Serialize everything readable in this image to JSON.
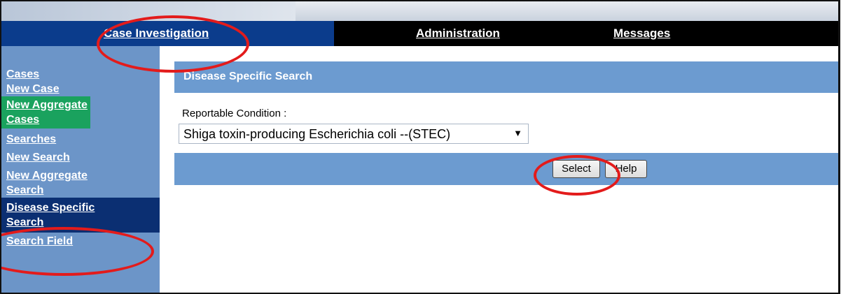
{
  "nav": {
    "case_investigation": "Case Investigation",
    "administration": "Administration",
    "messages": "Messages"
  },
  "sidebar": {
    "items": [
      {
        "label": "Cases"
      },
      {
        "label": "New Case"
      },
      {
        "label": "New Aggregate Cases"
      },
      {
        "label": "Searches"
      },
      {
        "label": "New Search"
      },
      {
        "label": "New Aggregate Search"
      },
      {
        "label": "Disease Specific Search"
      },
      {
        "label": "Search Field"
      }
    ]
  },
  "main": {
    "panel_title": "Disease Specific Search",
    "field_label": "Reportable Condition :",
    "selected_condition": "Shiga toxin-producing Escherichia coli --(STEC)",
    "select_button": "Select",
    "help_button": "Help"
  },
  "colors": {
    "nav_active": "#0b3c8c",
    "sidebar_bg": "#6c95c8",
    "sidebar_highlight": "#1aa25e",
    "sidebar_active": "#0b2f72",
    "panel_bg": "#6c9bd0",
    "annotation": "#e31b1b"
  }
}
